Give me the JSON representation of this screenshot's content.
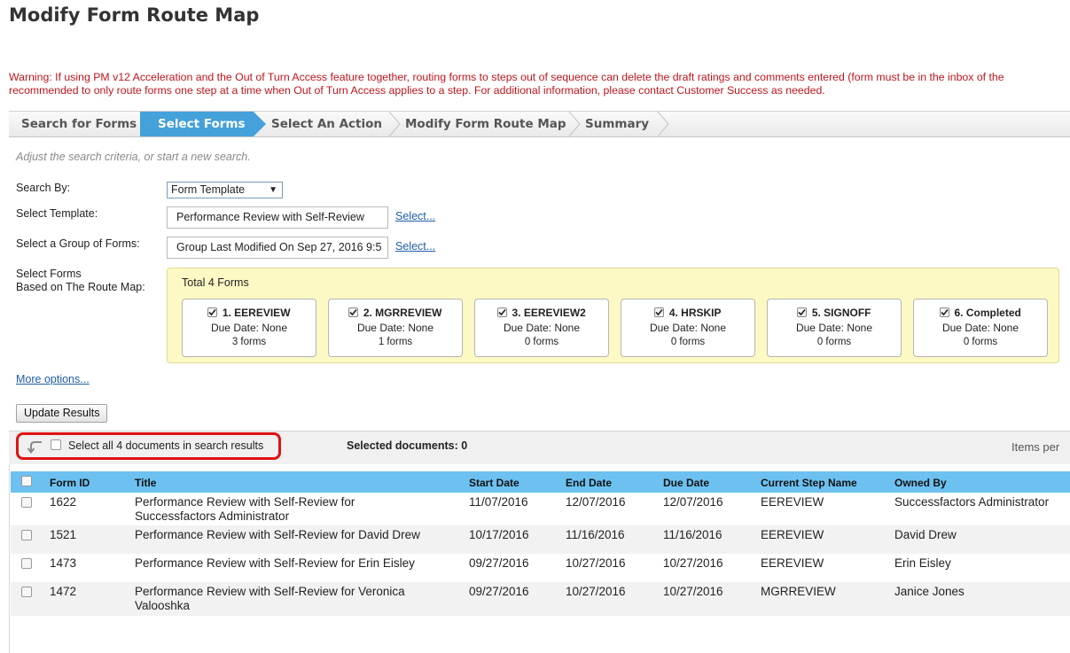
{
  "page": {
    "title": "Modify Form Route Map",
    "warning_line1": "Warning: If using PM v12 Acceleration and the Out of Turn Access feature together, routing forms to steps out of sequence can delete the draft ratings and comments entered (form must be in the inbox of the",
    "warning_line2": "recommended to only route forms one step at a time when Out of Turn Access applies to a step. For additional information, please contact Customer Success as needed."
  },
  "wizard": {
    "steps": [
      {
        "label": "Search for Forms"
      },
      {
        "label": "Select Forms"
      },
      {
        "label": "Select An Action"
      },
      {
        "label": "Modify Form Route Map"
      },
      {
        "label": "Summary"
      }
    ],
    "active_color": "#44a1d9"
  },
  "search": {
    "hint": "Adjust the search criteria, or start a new search.",
    "search_by_label": "Search By:",
    "search_by_value": "Form Template",
    "template_label": "Select Template:",
    "template_value": "Performance Review with Self-Review",
    "template_link": "Select...",
    "group_label": "Select a Group of Forms:",
    "group_value": "Group Last Modified On Sep 27, 2016 9:5",
    "group_link": "Select...",
    "route_label_line1": "Select Forms",
    "route_label_line2": "Based on The Route Map:",
    "more_options": "More options..."
  },
  "route_map": {
    "total": "Total 4 Forms",
    "steps": [
      {
        "name": "1. EEREVIEW",
        "due": "Due Date: None",
        "count": "3 forms"
      },
      {
        "name": "2. MGRREVIEW",
        "due": "Due Date: None",
        "count": "1 forms"
      },
      {
        "name": "3. EEREVIEW2",
        "due": "Due Date: None",
        "count": "0 forms"
      },
      {
        "name": "4. HRSKIP",
        "due": "Due Date: None",
        "count": "0 forms"
      },
      {
        "name": "5. SIGNOFF",
        "due": "Due Date: None",
        "count": "0 forms"
      },
      {
        "name": "6. Completed",
        "due": "Due Date: None",
        "count": "0 forms"
      }
    ]
  },
  "actions": {
    "update_results": "Update Results",
    "select_all": "Select all 4 documents in search results",
    "selected_documents": "Selected documents: 0",
    "items_per": "Items per"
  },
  "table": {
    "headers": [
      "Form ID",
      "Title",
      "Start Date",
      "End Date",
      "Due Date",
      "Current Step Name",
      "Owned By"
    ],
    "header_color": "#6cc1f0",
    "rows": [
      {
        "id": "1622",
        "title": "Performance Review with Self-Review for Successfactors Administrator",
        "start": "11/07/2016",
        "end": "12/07/2016",
        "due": "12/07/2016",
        "step": "EEREVIEW",
        "owner": "Successfactors Administrator"
      },
      {
        "id": "1521",
        "title": "Performance Review with Self-Review for David Drew",
        "start": "10/17/2016",
        "end": "11/16/2016",
        "due": "11/16/2016",
        "step": "EEREVIEW",
        "owner": "David Drew"
      },
      {
        "id": "1473",
        "title": "Performance Review with Self-Review for Erin Eisley",
        "start": "09/27/2016",
        "end": "10/27/2016",
        "due": "10/27/2016",
        "step": "EEREVIEW",
        "owner": "Erin Eisley"
      },
      {
        "id": "1472",
        "title": "Performance Review with Self-Review for Veronica Valooshka",
        "start": "09/27/2016",
        "end": "10/27/2016",
        "due": "10/27/2016",
        "step": "MGRREVIEW",
        "owner": "Janice Jones"
      }
    ]
  },
  "colors": {
    "warning": "#c0141c",
    "link": "#1f5ea8",
    "highlight_outline": "#e01212",
    "route_map_bg": "#fdf9c4"
  }
}
